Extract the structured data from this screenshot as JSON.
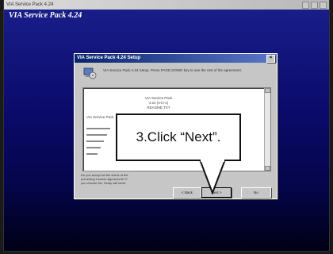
{
  "app": {
    "titlebar_text": "VIA Service Pack 4.24",
    "title": "VIA Service Pack 4.24"
  },
  "dialog": {
    "title": "VIA Service Pack 4.24 Setup",
    "close_glyph": "×",
    "message": "VIA Service Pack 4.24 Setup. Press PAGE DOWN key to see the rest of the agreement.",
    "agreement_lines": [
      "VIA Service Pack",
      "4.24 (4-in-1)",
      "README.TXT",
      "VIA Service Pack"
    ],
    "agree_prompt": "Do you accept all the terms of the preceding License Agreement? If you choose No, Setup will close.",
    "buttons": {
      "back": "< Back",
      "next": "Next >",
      "no": "No"
    }
  },
  "callout": {
    "text": "3.Click “Next”."
  },
  "icons": {
    "setup": "computer-disk-icon",
    "close": "close-icon"
  }
}
